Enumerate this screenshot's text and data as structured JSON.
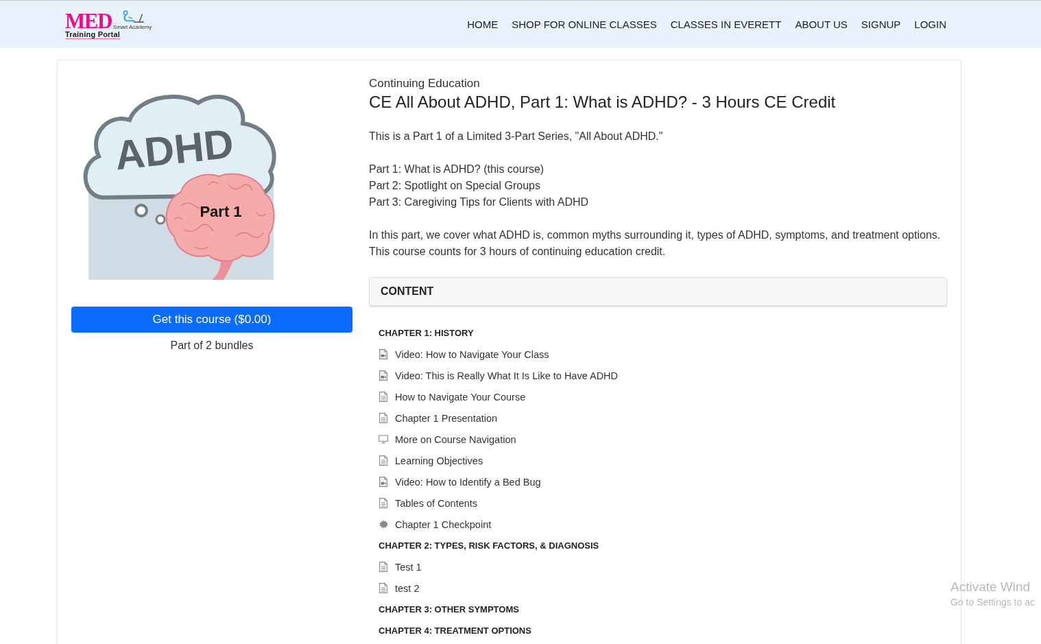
{
  "header": {
    "logo": {
      "wordmark": "MED",
      "tagline": "Smart Academy",
      "subtitle": "Training Portal"
    },
    "nav": [
      {
        "label": "HOME"
      },
      {
        "label": "SHOP FOR ONLINE CLASSES"
      },
      {
        "label": "CLASSES IN EVERETT"
      },
      {
        "label": "ABOUT US"
      },
      {
        "label": "SIGNUP"
      },
      {
        "label": "LOGIN"
      }
    ]
  },
  "course": {
    "image": {
      "title": "ADHD",
      "caption": "Part 1"
    },
    "buy_button": "Get this course ($0.00)",
    "bundles_note": "Part of 2 bundles",
    "category": "Continuing Education",
    "title": "CE All About ADHD, Part 1: What is ADHD? - 3 Hours CE Credit",
    "description": [
      {
        "lines": [
          "This is a Part 1 of a Limited 3-Part Series, \"All About ADHD.\""
        ]
      },
      {
        "lines": [
          "Part 1: What is ADHD? (this course)",
          "Part 2: Spotlight on Special Groups",
          "Part 3: Caregiving Tips for Clients with ADHD"
        ]
      },
      {
        "lines": [
          "In this part, we cover what ADHD is, common myths surrounding it, types of ADHD, symptoms, and treatment options.",
          "This course counts for 3 hours of continuing education credit."
        ]
      }
    ],
    "content": {
      "heading": "CONTENT",
      "chapters": [
        {
          "title": "CHAPTER 1: HISTORY",
          "items": [
            {
              "kind": "video",
              "label": "Video: How to Navigate Your Class"
            },
            {
              "kind": "video",
              "label": "Video: This is Really What It Is Like to Have ADHD"
            },
            {
              "kind": "document",
              "label": "How to Navigate Your Course"
            },
            {
              "kind": "document",
              "label": "Chapter 1 Presentation"
            },
            {
              "kind": "screen",
              "label": "More on Course Navigation"
            },
            {
              "kind": "document",
              "label": "Learning Objectives"
            },
            {
              "kind": "video",
              "label": "Video: How to Identify a Bed Bug"
            },
            {
              "kind": "document",
              "label": "Tables of Contents"
            },
            {
              "kind": "quiz",
              "label": "Chapter 1 Checkpoint"
            }
          ]
        },
        {
          "title": "CHAPTER 2: TYPES, RISK FACTORS, & DIAGNOSIS",
          "items": [
            {
              "kind": "document",
              "label": "Test 1"
            },
            {
              "kind": "document",
              "label": "test 2"
            }
          ]
        },
        {
          "title": "CHAPTER 3: OTHER SYMPTOMS"
        },
        {
          "title": "CHAPTER 4: TREATMENT OPTIONS"
        }
      ]
    }
  },
  "os_overlay": {
    "title": "Activate Wind",
    "text": "Go to Settings to ac"
  }
}
